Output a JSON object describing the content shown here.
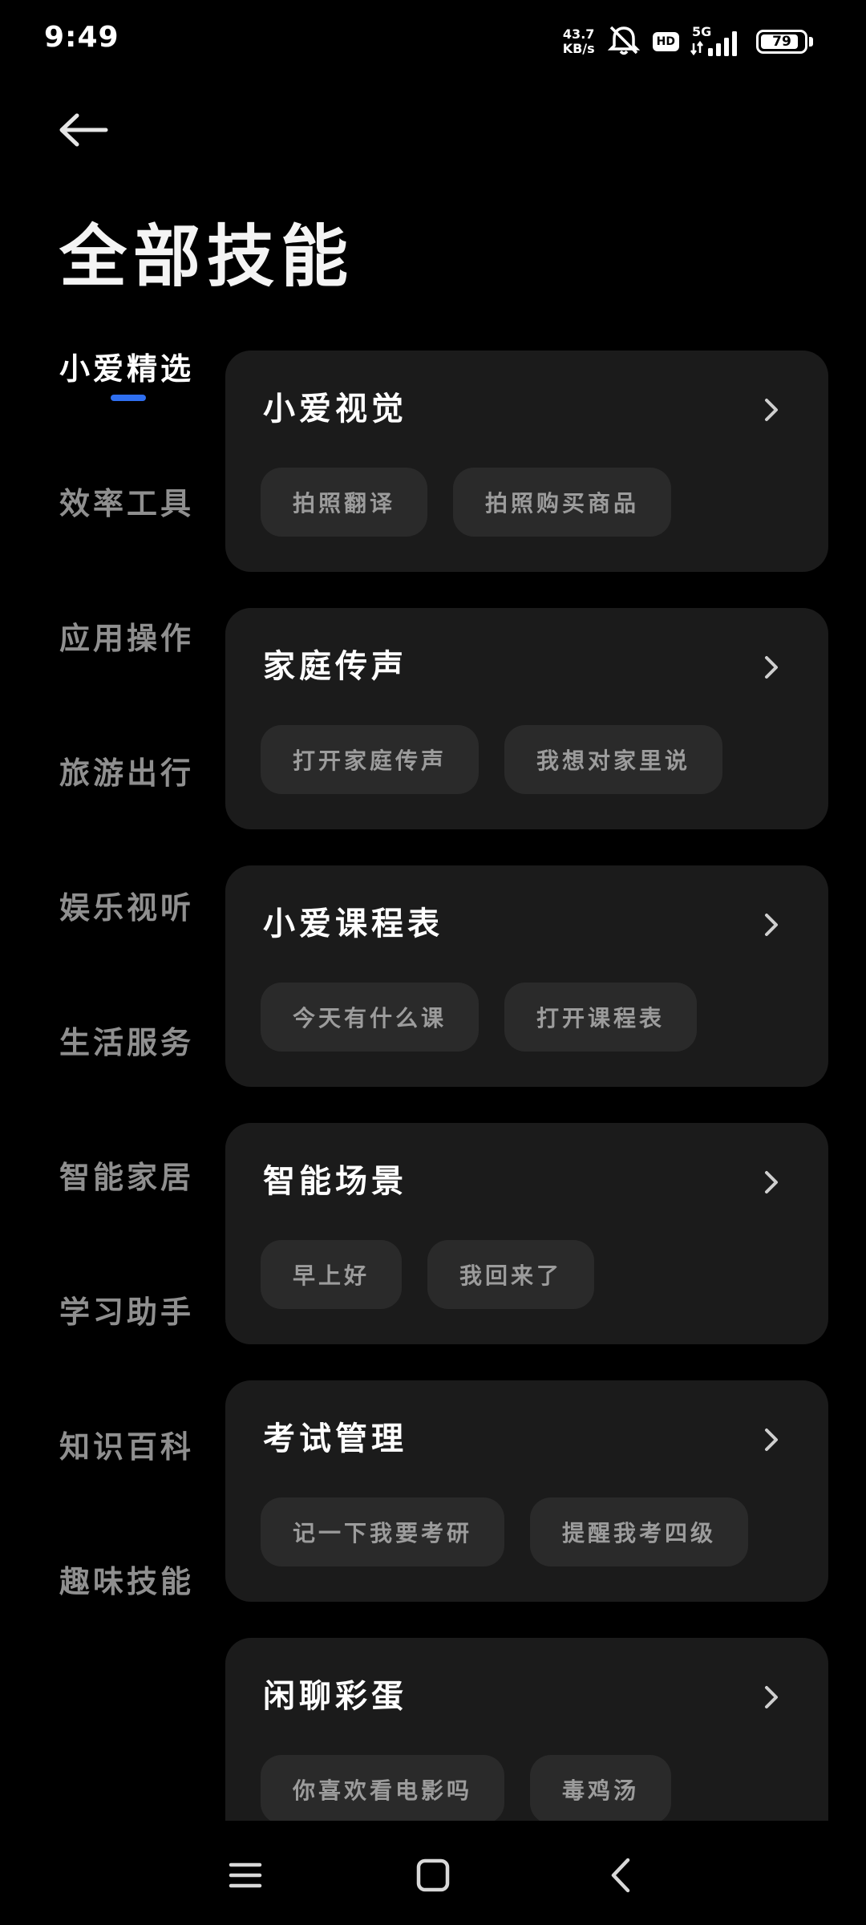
{
  "status_bar": {
    "time": "9:49",
    "net_speed_value": "43.7",
    "net_speed_unit": "KB/s",
    "hd_label": "HD",
    "network_type": "5G",
    "battery_level": "79"
  },
  "header": {
    "title": "全部技能"
  },
  "categories": [
    {
      "label": "小爱精选",
      "active": true
    },
    {
      "label": "效率工具"
    },
    {
      "label": "应用操作"
    },
    {
      "label": "旅游出行"
    },
    {
      "label": "娱乐视听"
    },
    {
      "label": "生活服务"
    },
    {
      "label": "智能家居"
    },
    {
      "label": "学习助手"
    },
    {
      "label": "知识百科"
    },
    {
      "label": "趣味技能"
    }
  ],
  "cards": [
    {
      "title": "小爱视觉",
      "chips": [
        "拍照翻译",
        "拍照购买商品"
      ]
    },
    {
      "title": "家庭传声",
      "chips": [
        "打开家庭传声",
        "我想对家里说"
      ]
    },
    {
      "title": "小爱课程表",
      "chips": [
        "今天有什么课",
        "打开课程表"
      ]
    },
    {
      "title": "智能场景",
      "chips": [
        "早上好",
        "我回来了"
      ]
    },
    {
      "title": "考试管理",
      "chips": [
        "记一下我要考研",
        "提醒我考四级"
      ]
    },
    {
      "title": "闲聊彩蛋",
      "chips": [
        "你喜欢看电影吗",
        "毒鸡汤"
      ]
    }
  ],
  "colors": {
    "background": "#000000",
    "card": "#1b1b1b",
    "chip": "#2a2a2a",
    "accent": "#2f6ff0"
  },
  "icons": {
    "back": "arrow-left-icon",
    "chevron": "chevron-right-icon",
    "nav_menu": "menu-icon",
    "nav_home": "home-square-icon",
    "nav_back": "back-chevron-icon"
  }
}
